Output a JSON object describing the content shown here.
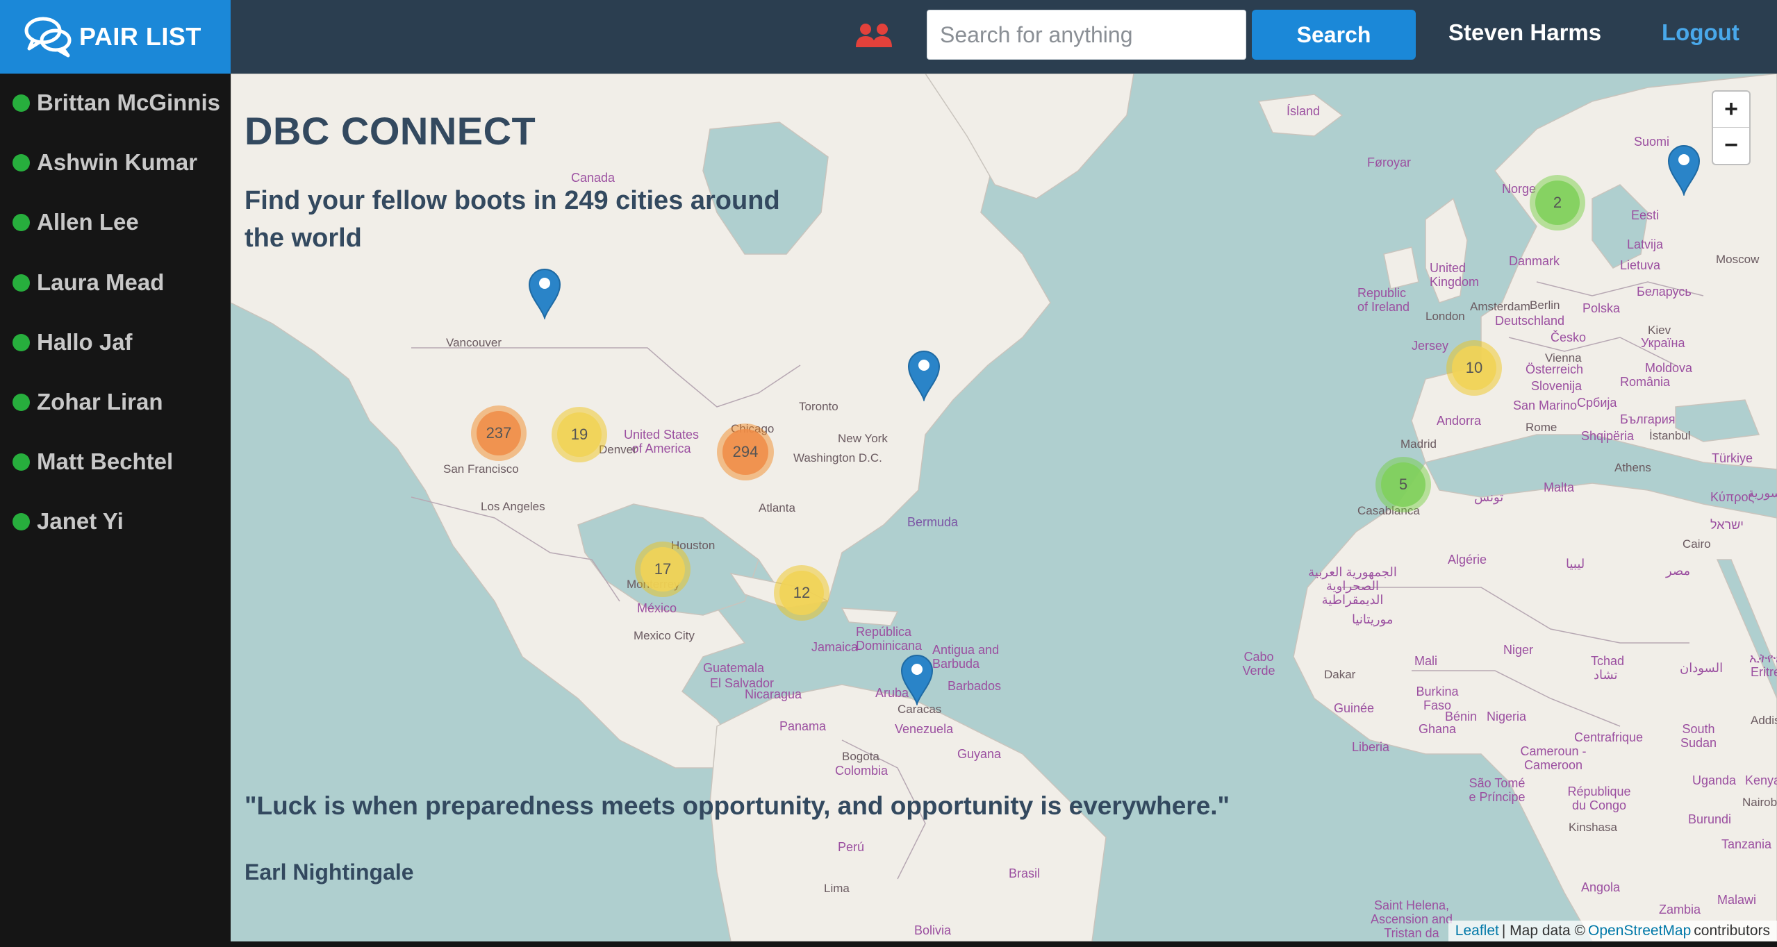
{
  "brand": {
    "name": "PAIR LIST",
    "icon": "chat-bubbles-icon"
  },
  "header": {
    "users_icon": "users-icon",
    "search_placeholder": "Search for anything",
    "search_button": "Search",
    "user_name": "Steven Harms",
    "logout": "Logout"
  },
  "sidebar": {
    "items": [
      {
        "name": "Brittan McGinnis",
        "status": "online"
      },
      {
        "name": "Ashwin Kumar",
        "status": "online"
      },
      {
        "name": "Allen Lee",
        "status": "online"
      },
      {
        "name": "Laura Mead",
        "status": "online"
      },
      {
        "name": "Hallo Jaf",
        "status": "online"
      },
      {
        "name": "Zohar Liran",
        "status": "online"
      },
      {
        "name": "Matt Bechtel",
        "status": "online"
      },
      {
        "name": "Janet Yi",
        "status": "online"
      }
    ]
  },
  "main": {
    "title": "DBC CONNECT",
    "subtitle": "Find your fellow boots in 249 cities around the world",
    "quote": "\"Luck is when preparedness meets opportunity, and opportunity is everywhere.\"",
    "author": "Earl Nightingale"
  },
  "map": {
    "clusters": [
      {
        "count": "237",
        "color": "orange"
      },
      {
        "count": "19",
        "color": "yellow"
      },
      {
        "count": "294",
        "color": "orange"
      },
      {
        "count": "17",
        "color": "yellow"
      },
      {
        "count": "12",
        "color": "yellow"
      },
      {
        "count": "10",
        "color": "yellow"
      },
      {
        "count": "5",
        "color": "green"
      },
      {
        "count": "2",
        "color": "green"
      }
    ],
    "labels": {
      "canada": "Canada",
      "usa": "United States of America",
      "mexico": "México",
      "vancouver": "Vancouver",
      "san_francisco": "San Francisco",
      "los_angeles": "Los Angeles",
      "denver": "Denver",
      "chicago": "Chicago",
      "toronto": "Toronto",
      "new_york": "New York",
      "washington": "Washington D.C.",
      "atlanta": "Atlanta",
      "houston": "Houston",
      "monterrey": "Monterrey",
      "mexico_city": "Mexico City",
      "bermuda": "Bermuda",
      "guatemala": "Guatemala",
      "el_salvador": "El Salvador",
      "nicaragua": "Nicaragua",
      "panama": "Panama",
      "jamaica": "Jamaica",
      "republica_dominicana": "República Dominicana",
      "antigua": "Antigua and Barbuda",
      "barbados": "Barbados",
      "aruba": "Aruba",
      "caracas": "Caracas",
      "venezuela": "Venezuela",
      "guyana": "Guyana",
      "bogota": "Bogota",
      "colombia": "Colombia",
      "peru": "Perú",
      "brasil": "Brasil",
      "bolivia": "Bolivia",
      "lima": "Lima",
      "island": "Ísland",
      "foroyar": "Føroyar",
      "norge": "Norge",
      "suomi": "Suomi",
      "danmark": "Danmark",
      "eesti": "Eesti",
      "latvija": "Latvija",
      "lietuva": "Lietuva",
      "moscow": "Moscow",
      "united_kingdom": "United Kingdom",
      "republic_of_ireland": "Republic of Ireland",
      "london": "London",
      "amsterdam": "Amsterdam",
      "berlin": "Berlin",
      "deutschland": "Deutschland",
      "polska": "Polska",
      "belarus": "Беларусь",
      "cesko": "Česko",
      "kiev": "Kiev",
      "ukraina": "Україна",
      "jersey": "Jersey",
      "vienna": "Vienna",
      "osterreich": "Österreich",
      "slovenija": "Slovenija",
      "moldova": "Moldova",
      "romania": "România",
      "srbija": "Србија",
      "bulgaria": "България",
      "andorra": "Andorra",
      "madrid": "Madrid",
      "san_marino": "San Marino",
      "rome": "Rome",
      "shqiperia": "Shqipëria",
      "istanbul": "İstanbul",
      "athens": "Athens",
      "turkiye": "Türkiye",
      "malta": "Malta",
      "kibris": "Κύπρος",
      "casablanca": "Casablanca",
      "algerie": "Algérie",
      "tunisia": "تونس",
      "libya": "ليبيا",
      "egypt": "مصر",
      "cairo": "Cairo",
      "israel": "ישראל",
      "syria": "سورية",
      "mauritania": "موريتانيا",
      "western_sahara": "الجمهورية العربية الصحراوية الديمقراطية",
      "mali": "Mali",
      "niger": "Niger",
      "tchad": "Tchad",
      "tchad_ar": "تشاد",
      "sudan": "السودان",
      "eritrea": "Eritrea",
      "ethiopia": "ኢትዮጵያ",
      "dakar": "Dakar",
      "cabo_verde": "Cabo Verde",
      "guinee": "Guinée",
      "burkina_faso": "Burkina Faso",
      "benin": "Bénin",
      "nigeria": "Nigeria",
      "ghana": "Ghana",
      "liberia": "Liberia",
      "south_sudan": "South Sudan",
      "addis_ababa": "Addis Ababa",
      "centrafrique": "Centrafrique",
      "cameroun": "Cameroun - Cameroon",
      "sao_tome": "São Tomé e Príncipe",
      "rdc": "République du Congo",
      "kinshasa": "Kinshasa",
      "uganda": "Uganda",
      "kenya": "Kenya",
      "nairobi": "Nairobi",
      "burundi": "Burundi",
      "tanzania": "Tanzania",
      "angola": "Angola",
      "malawi": "Malawi",
      "zambia": "Zambia",
      "saint_helena": "Saint Helena, Ascension and Tristan da Cunha"
    }
  },
  "zoom": {
    "in": "+",
    "out": "−"
  },
  "attribution": {
    "leaflet": "Leaflet",
    "separator": "| Map data ©",
    "osm": "OpenStreetMap",
    "contributors": "contributors"
  }
}
